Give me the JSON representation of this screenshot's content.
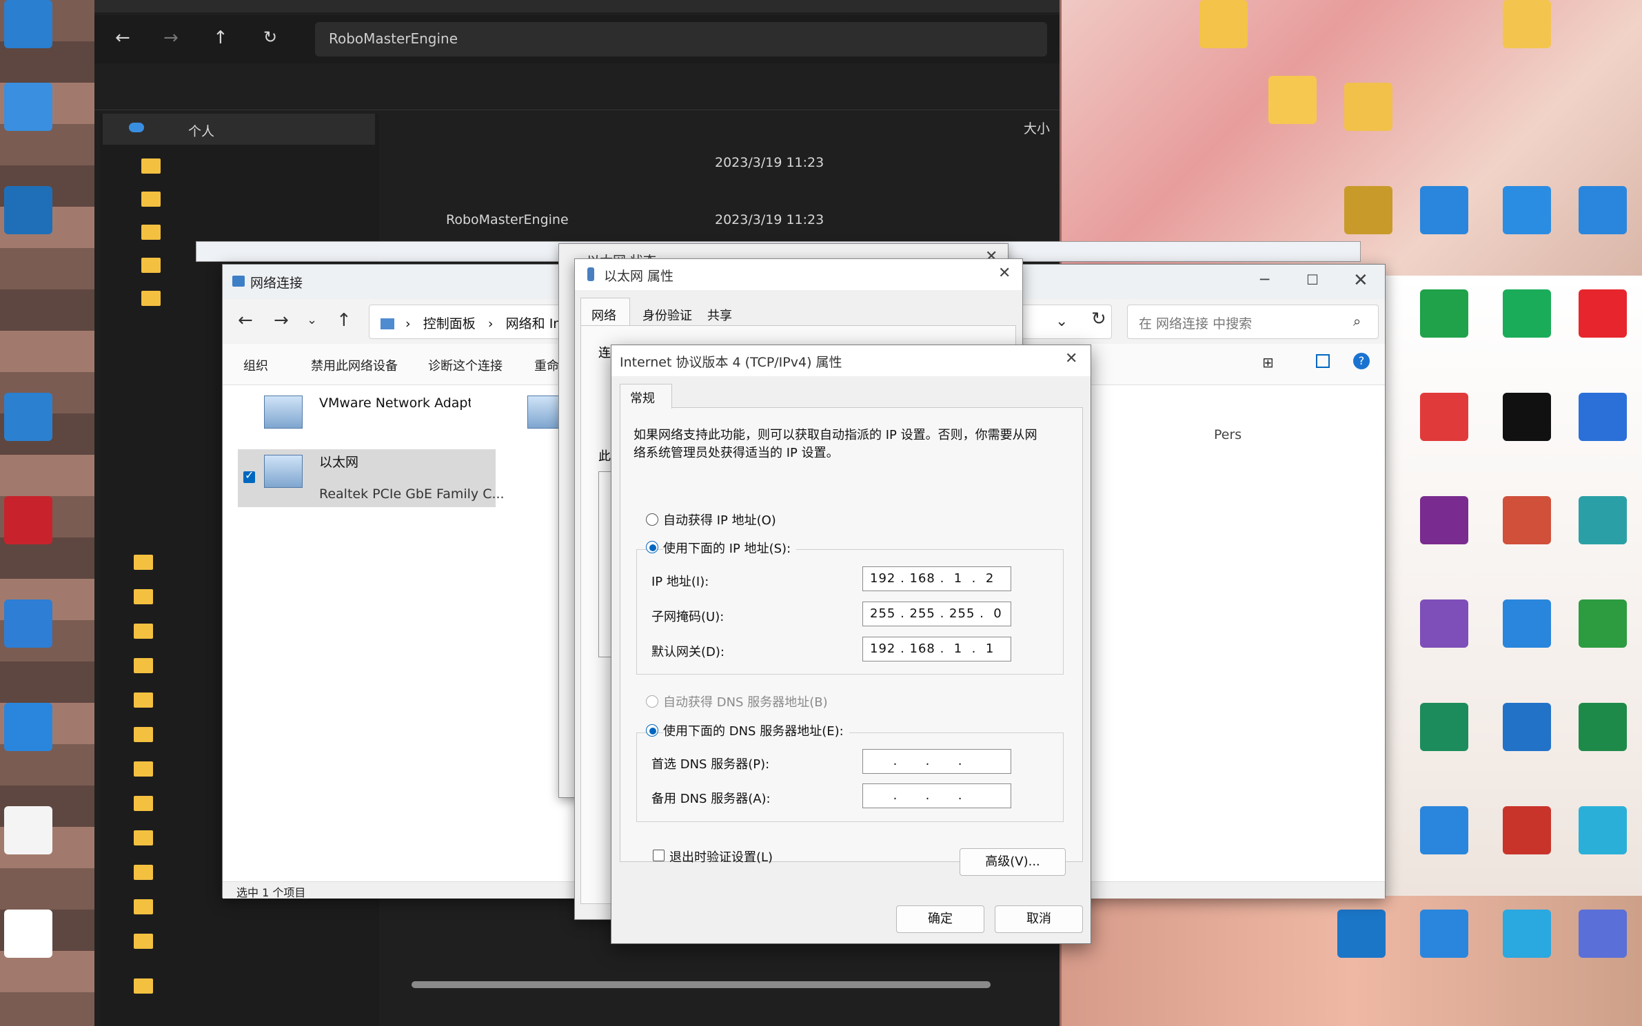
{
  "dark_explorer": {
    "nav_selected": "个人",
    "timestamps": [
      "2023/3/19 11:23",
      "2023/3/19 11:23"
    ],
    "file_name": "RoboMasterEngine",
    "size_header": "大小"
  },
  "network_window": {
    "title": "网络连接",
    "breadcrumb": [
      "控制面板",
      "网络和 Intern"
    ],
    "search_placeholder": "在 网络连接 中搜索",
    "commands": [
      "组织",
      "禁用此网络设备",
      "诊断这个连接",
      "重命"
    ],
    "items": [
      {
        "name": "VMware Network Adapter",
        "sub": ""
      },
      {
        "name": "以太网",
        "sub": "Realtek PCIe GbE Family C..."
      }
    ],
    "other_item_label": "Pers",
    "status": "选中 1 个项目"
  },
  "ethernet_status": {
    "title": "以太网 状态"
  },
  "ethernet_props": {
    "title": "以太网 属性",
    "tabs": [
      "网络",
      "身份验证",
      "共享"
    ],
    "partial_labels": [
      "连",
      "此"
    ]
  },
  "ipv4_dialog": {
    "title": "Internet 协议版本 4 (TCP/IPv4) 属性",
    "tab": "常规",
    "description": "如果网络支持此功能，则可以获取自动指派的 IP 设置。否则，你需要从网络系统管理员处获得适当的 IP 设置。",
    "auto_ip_label": "自动获得 IP 地址(O)",
    "manual_ip_label": "使用下面的 IP 地址(S):",
    "ip_label": "IP 地址(I):",
    "ip_value": "192 . 168 .  1  .  2",
    "mask_label": "子网掩码(U):",
    "mask_value": "255 . 255 . 255 .  0",
    "gateway_label": "默认网关(D):",
    "gateway_value": "192 . 168 .  1  .  1",
    "auto_dns_label": "自动获得 DNS 服务器地址(B)",
    "manual_dns_label": "使用下面的 DNS 服务器地址(E):",
    "pref_dns_label": "首选 DNS 服务器(P):",
    "pref_dns_value": "     .      .      .",
    "alt_dns_label": "备用 DNS 服务器(A):",
    "alt_dns_value": "     .      .      .",
    "validate_label": "退出时验证设置(L)",
    "advanced_label": "高级(V)...",
    "ok_label": "确定",
    "cancel_label": "取消"
  },
  "colors": {
    "accent": "#0067c0",
    "dark_bg": "#1f1f1f"
  }
}
